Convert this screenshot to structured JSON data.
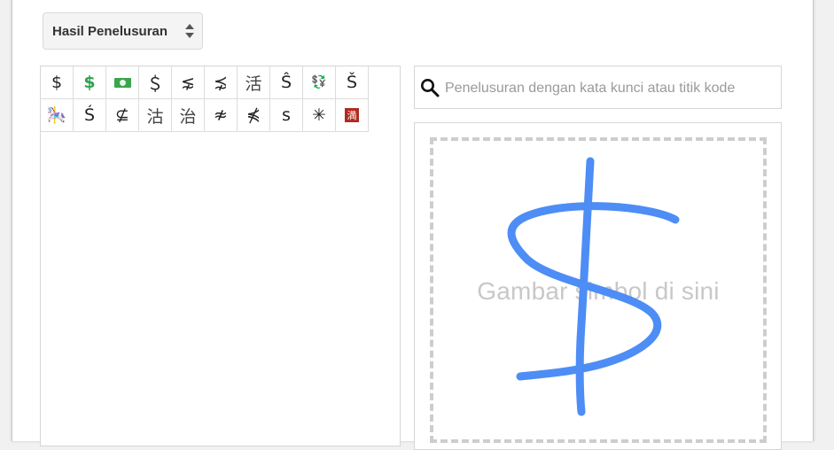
{
  "mode_select": {
    "label": "Hasil Penelusuran"
  },
  "results": {
    "symbols": [
      {
        "char": "$",
        "style": "plain"
      },
      {
        "char": "$",
        "style": "green"
      },
      {
        "char": "$",
        "style": "bill"
      },
      {
        "char": "＄",
        "style": "plain"
      },
      {
        "char": "⋦",
        "style": "plain"
      },
      {
        "char": "⋨",
        "style": "plain"
      },
      {
        "char": "活",
        "style": "cjk"
      },
      {
        "char": "Ŝ",
        "style": "plain"
      },
      {
        "char": "💱",
        "style": "exchange"
      },
      {
        "char": "Š",
        "style": "plain"
      },
      {
        "char": "🎠",
        "style": "yellow"
      },
      {
        "char": "Ś",
        "style": "plain"
      },
      {
        "char": "⊈",
        "style": "plain"
      },
      {
        "char": "沽",
        "style": "cjk"
      },
      {
        "char": "治",
        "style": "cjk"
      },
      {
        "char": "≉",
        "style": "plain"
      },
      {
        "char": "⋠",
        "style": "plain"
      },
      {
        "char": "s",
        "style": "plain"
      },
      {
        "char": "✳",
        "style": "plain"
      },
      {
        "char": "満",
        "style": "redbox"
      }
    ]
  },
  "search": {
    "placeholder": "Penelusuran dengan kata kunci atau titik kode",
    "icon": "search-icon"
  },
  "drawing": {
    "hint": "Gambar simbol di sini",
    "stroke_color": "#4d8df5"
  }
}
